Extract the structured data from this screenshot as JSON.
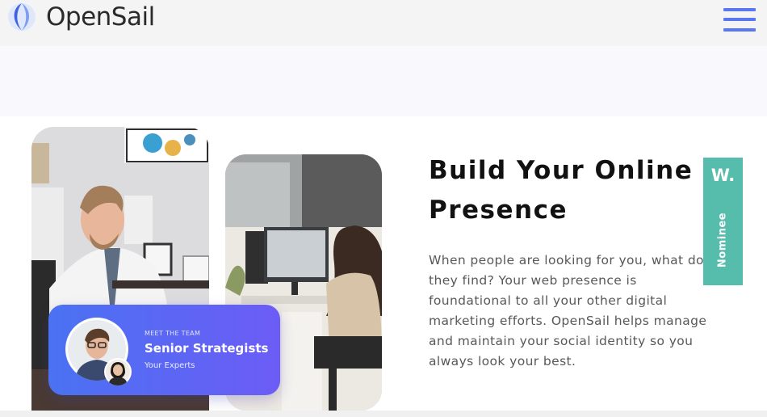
{
  "header": {
    "brand": "OpenSail",
    "logo_icon": "sail-swirl-logo",
    "menu_icon": "hamburger-menu-icon"
  },
  "colors": {
    "accent": "#5877f0",
    "card_gradient_start": "#4a72f2",
    "card_gradient_end": "#6c5cf6",
    "badge": "#56bcac",
    "band": "#f8f8fd"
  },
  "hero": {
    "title": "Build Your Online Presence",
    "body": "When people are looking for you, what do they find? Your web presence is foundational to all your other digital marketing efforts. OpenSail helps manage and maintain your social identity so you always look your best."
  },
  "team_card": {
    "kicker": "MEET THE TEAM",
    "title": "Senior Strategists",
    "subtitle": "Your Experts"
  },
  "badge": {
    "letter": "W.",
    "label": "Nominee"
  }
}
